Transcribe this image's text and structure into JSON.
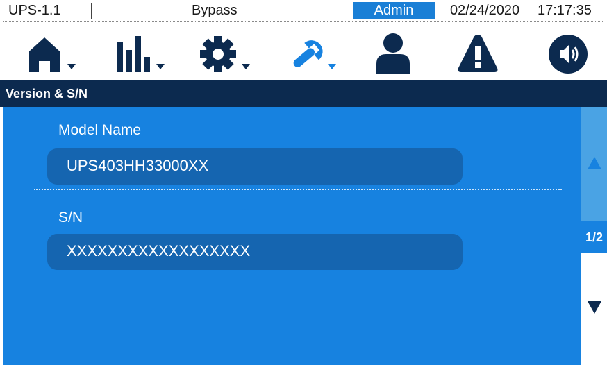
{
  "status_bar": {
    "device": "UPS-1.1",
    "mode": "Bypass",
    "user": "Admin",
    "date": "02/24/2020",
    "time": "17:17:35"
  },
  "nav": {
    "items": [
      {
        "name": "home",
        "icon": "home-icon",
        "has_dropdown": true
      },
      {
        "name": "measurements",
        "icon": "bar-chart-icon",
        "has_dropdown": true
      },
      {
        "name": "settings",
        "icon": "gear-icon",
        "has_dropdown": true,
        "selected": false
      },
      {
        "name": "maintenance",
        "icon": "wrench-icon",
        "has_dropdown": true,
        "selected": true
      },
      {
        "name": "user",
        "icon": "user-icon",
        "has_dropdown": false
      },
      {
        "name": "alarms",
        "icon": "warning-icon",
        "has_dropdown": false
      },
      {
        "name": "sound",
        "icon": "speaker-icon",
        "has_dropdown": false
      }
    ]
  },
  "page": {
    "title": "Version & S/N"
  },
  "fields": {
    "model_label": "Model Name",
    "model_value": "UPS403HH33000XX",
    "sn_label": "S/N",
    "sn_value": "XXXXXXXXXXXXXXXXXX"
  },
  "pager": {
    "page_indicator": "1/2"
  },
  "colors": {
    "navy": "#0c2a4f",
    "content_blue": "#1782e0",
    "field_blue": "#1565b0",
    "accent_blue": "#1a7fd6"
  }
}
